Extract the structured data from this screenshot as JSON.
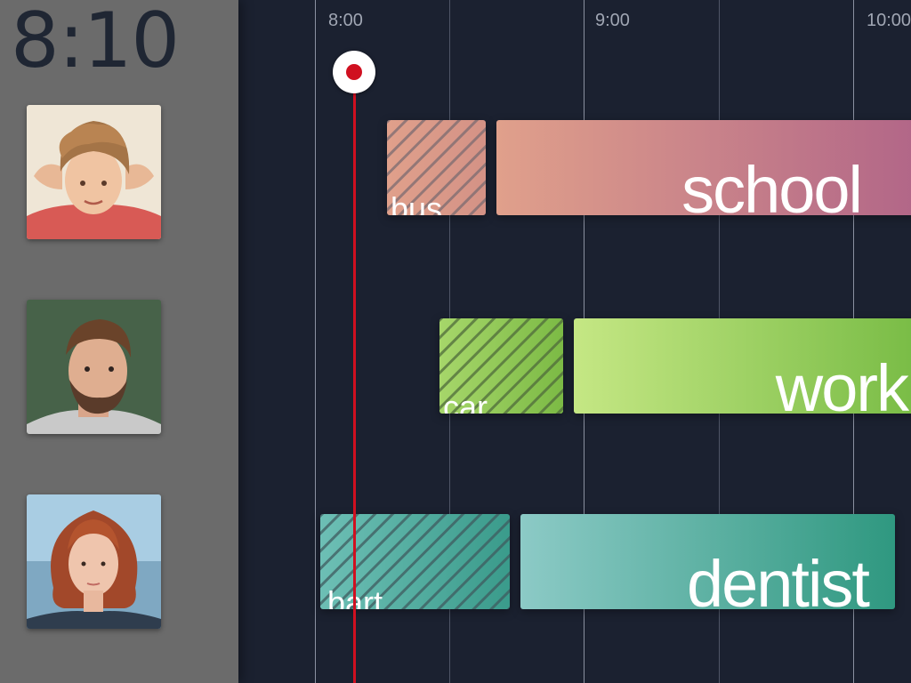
{
  "clock": "8:10",
  "timeline": {
    "hour_labels": [
      "8:00",
      "9:00",
      "10:00"
    ],
    "now_marker": "current-time"
  },
  "people": [
    {
      "avatar": "boy-portrait",
      "travel": {
        "label": "bus",
        "color_start": "#e0a08b",
        "color_end": "#d49286"
      },
      "event": {
        "label": "school",
        "color_start": "#e0a08b",
        "color_end": "#b06488"
      }
    },
    {
      "avatar": "bearded-man-portrait",
      "travel": {
        "label": "car",
        "color_start": "#a6d66a",
        "color_end": "#7cba45"
      },
      "event": {
        "label": "work",
        "color_start": "#c5e784",
        "color_end": "#72b840"
      }
    },
    {
      "avatar": "red-haired-woman-portrait",
      "travel": {
        "label": "bart",
        "color_start": "#6dbfb5",
        "color_end": "#3a9b8b"
      },
      "event": {
        "label": "dentist",
        "color_start": "#8ccac6",
        "color_end": "#2f9880"
      }
    }
  ]
}
